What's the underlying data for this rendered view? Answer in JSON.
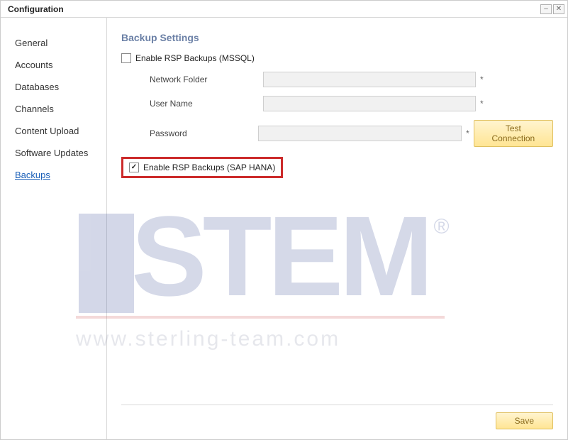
{
  "window": {
    "title": "Configuration"
  },
  "sidebar": {
    "items": [
      {
        "label": "General"
      },
      {
        "label": "Accounts"
      },
      {
        "label": "Databases"
      },
      {
        "label": "Channels"
      },
      {
        "label": "Content Upload"
      },
      {
        "label": "Software Updates"
      },
      {
        "label": "Backups",
        "active": true
      }
    ]
  },
  "section": {
    "title": "Backup Settings",
    "mssql_label": "Enable RSP Backups (MSSQL)",
    "mssql_checked": false,
    "fields": {
      "network_folder": {
        "label": "Network Folder",
        "value": ""
      },
      "user_name": {
        "label": "User Name",
        "value": ""
      },
      "password": {
        "label": "Password",
        "value": ""
      }
    },
    "test_btn": "Test Connection",
    "hana_label": "Enable RSP Backups (SAP HANA)",
    "hana_checked": true,
    "save_btn": "Save"
  },
  "watermark": {
    "brand": "STEM",
    "url": "www.sterling-team.com"
  }
}
